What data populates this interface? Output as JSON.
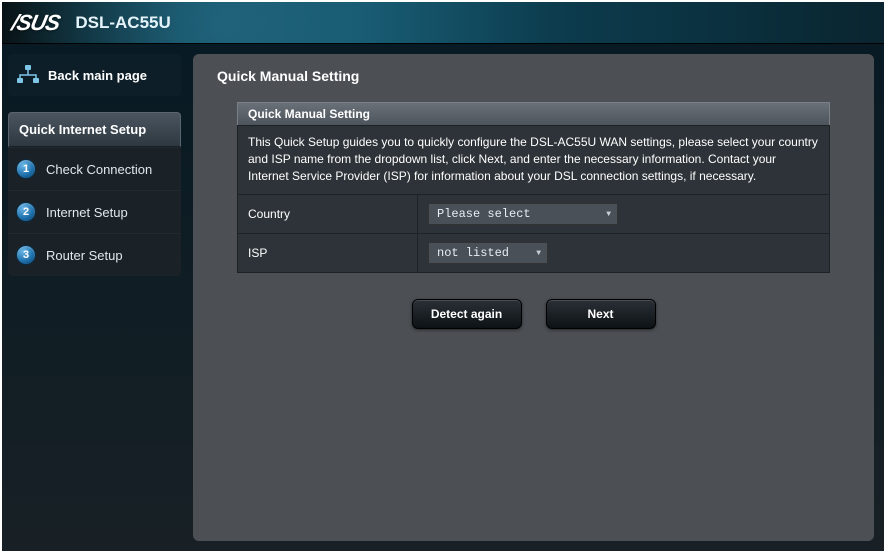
{
  "header": {
    "brand": "/SUS",
    "model": "DSL-AC55U"
  },
  "sidebar": {
    "back_label": "Back main page",
    "setup_title": "Quick Internet Setup",
    "steps": [
      {
        "num": "1",
        "label": "Check Connection"
      },
      {
        "num": "2",
        "label": "Internet Setup"
      },
      {
        "num": "3",
        "label": "Router Setup"
      }
    ]
  },
  "main": {
    "title": "Quick Manual Setting",
    "inner_title": "Quick Manual Setting",
    "description": "This Quick Setup guides you to quickly configure the DSL-AC55U WAN settings, please select your country and ISP name from the dropdown list, click Next, and enter the necessary information. Contact your Internet Service Provider (ISP) for information about your DSL connection settings, if necessary.",
    "fields": {
      "country_label": "Country",
      "country_value": "Please select",
      "isp_label": "ISP",
      "isp_value": "not listed"
    },
    "buttons": {
      "detect": "Detect again",
      "next": "Next"
    }
  }
}
